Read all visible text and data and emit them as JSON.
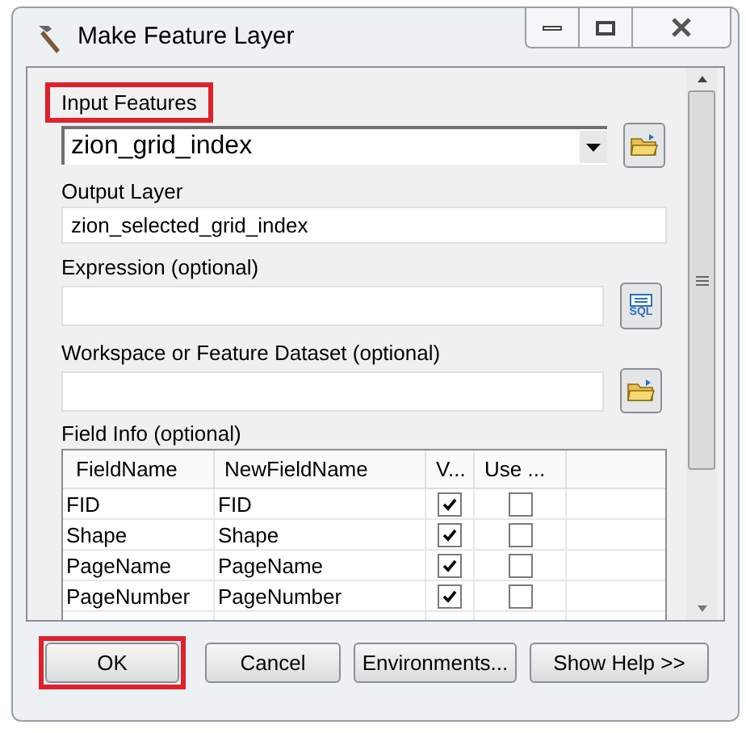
{
  "window": {
    "title": "Make Feature Layer"
  },
  "params": [
    {
      "kind": "combo",
      "label": "Input Features",
      "highlighted": true,
      "value": "zion_grid_index",
      "button": {
        "kind": "folder"
      }
    },
    {
      "kind": "text",
      "label": "Output Layer",
      "highlighted": false,
      "value": "zion_selected_grid_index"
    },
    {
      "kind": "text",
      "label": "Expression (optional)",
      "highlighted": false,
      "button": {
        "kind": "sql",
        "text": "SQL"
      }
    },
    {
      "kind": "text",
      "label": "Workspace or Feature Dataset (optional)",
      "highlighted": false,
      "button": {
        "kind": "folder"
      }
    }
  ],
  "field_info": {
    "label": "Field Info (optional)",
    "columns": [
      "FieldName",
      "NewFieldName",
      "V...",
      "Use ..."
    ],
    "rows": [
      {
        "field": "FID",
        "new_name": "FID",
        "visible": true,
        "use_ratio": false
      },
      {
        "field": "Shape",
        "new_name": "Shape",
        "visible": true,
        "use_ratio": false
      },
      {
        "field": "PageName",
        "new_name": "PageName",
        "visible": true,
        "use_ratio": false
      },
      {
        "field": "PageNumber",
        "new_name": "PageNumber",
        "visible": true,
        "use_ratio": false
      }
    ]
  },
  "buttons": [
    {
      "label": "OK",
      "highlighted": true
    },
    {
      "label": "Cancel",
      "highlighted": false
    },
    {
      "label": "Environments...",
      "highlighted": false
    },
    {
      "label": "Show Help >>",
      "highlighted": false
    }
  ]
}
